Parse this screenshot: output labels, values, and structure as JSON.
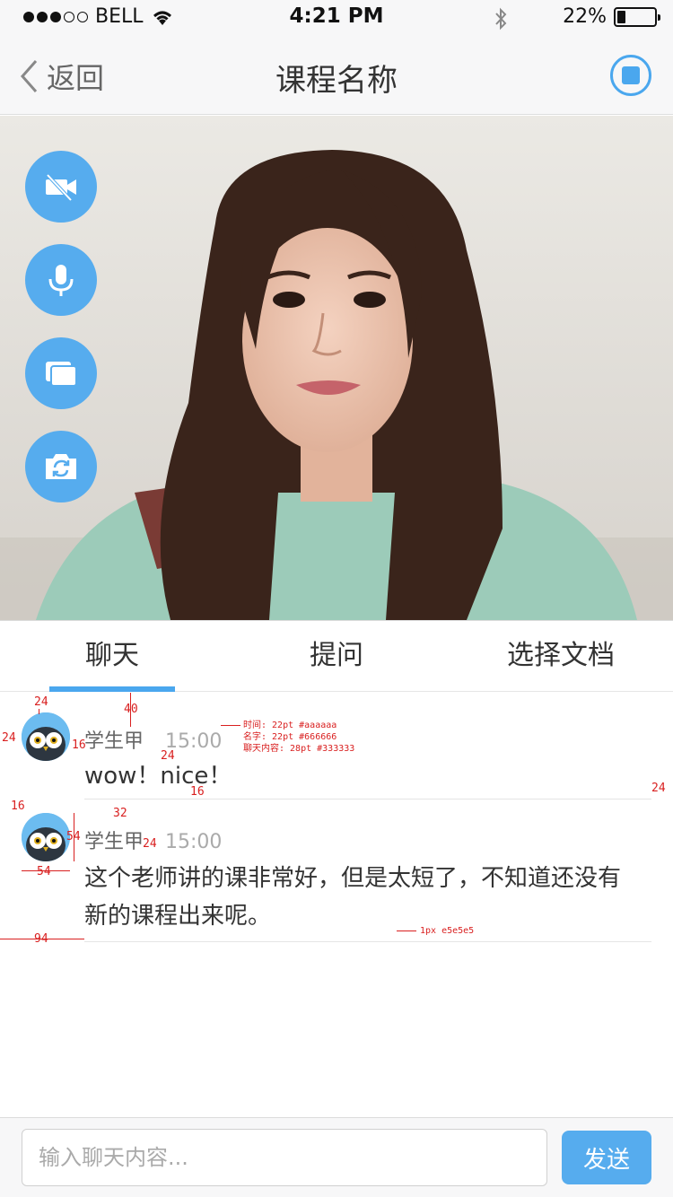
{
  "status_bar": {
    "carrier": "BELL",
    "time": "4:21 PM",
    "battery_percent": "22%",
    "battery_level": 0.22
  },
  "nav": {
    "back_label": "返回",
    "title": "课程名称"
  },
  "video_controls": [
    {
      "icon": "camera-off-icon"
    },
    {
      "icon": "microphone-icon"
    },
    {
      "icon": "screen-share-icon"
    },
    {
      "icon": "switch-camera-icon"
    }
  ],
  "tabs": [
    {
      "label": "聊天",
      "active": true
    },
    {
      "label": "提问",
      "active": false
    },
    {
      "label": "选择文档",
      "active": false
    }
  ],
  "messages": [
    {
      "name": "学生甲",
      "time": "15:00",
      "text": "wow！nice！"
    },
    {
      "name": "学生甲",
      "time": "15:00",
      "text": "这个老师讲的课非常好，但是太短了，不知道还没有新的课程出来呢。"
    }
  ],
  "annotations": {
    "a24_top": "24",
    "a40": "40",
    "a24_left": "24",
    "a16_avatar": "16",
    "a24_name": "24",
    "a16_text": "16",
    "a24_right": "24",
    "a16_gap": "16",
    "a32": "32",
    "a54_height": "54",
    "a24_name2": "24",
    "a54_width": "54",
    "a94": "94",
    "note_time": "时间: 22pt #aaaaaa",
    "note_name": "名字: 22pt #666666",
    "note_content": "聊天内容: 28pt #333333",
    "note_line": "1px e5e5e5"
  },
  "input": {
    "placeholder": "输入聊天内容...",
    "send_label": "发送"
  },
  "colors": {
    "accent": "#4aa7ee",
    "button": "#56acee",
    "time": "#aaaaaa",
    "name": "#666666",
    "content": "#333333",
    "divider": "#e5e5e5"
  }
}
